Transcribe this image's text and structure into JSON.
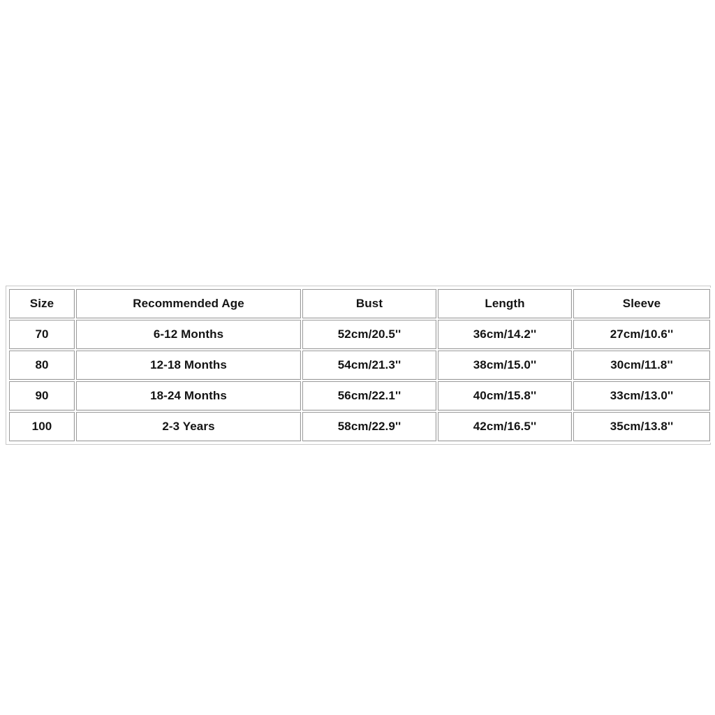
{
  "page": {
    "background_color": "#ffffff",
    "text_color": "#141414",
    "border_color": "#9a9a9a"
  },
  "size_chart": {
    "columns": [
      "Size",
      "Recommended Age",
      "Bust",
      "Length",
      "Sleeve"
    ],
    "rows": [
      {
        "size": "70",
        "age": "6-12 Months",
        "bust": "52cm/20.5''",
        "length": "36cm/14.2''",
        "sleeve": "27cm/10.6''"
      },
      {
        "size": "80",
        "age": "12-18 Months",
        "bust": "54cm/21.3''",
        "length": "38cm/15.0''",
        "sleeve": "30cm/11.8''"
      },
      {
        "size": "90",
        "age": "18-24 Months",
        "bust": "56cm/22.1''",
        "length": "40cm/15.8''",
        "sleeve": "33cm/13.0''"
      },
      {
        "size": "100",
        "age": "2-3 Years",
        "bust": "58cm/22.9''",
        "length": "42cm/16.5''",
        "sleeve": "35cm/13.8''"
      }
    ]
  },
  "chart_data": {
    "type": "table",
    "title": "",
    "columns": [
      "Size",
      "Recommended Age",
      "Bust",
      "Length",
      "Sleeve"
    ],
    "rows": [
      [
        "70",
        "6-12 Months",
        "52cm/20.5''",
        "36cm/14.2''",
        "27cm/10.6''"
      ],
      [
        "80",
        "12-18 Months",
        "54cm/21.3''",
        "38cm/15.0''",
        "30cm/11.8''"
      ],
      [
        "90",
        "18-24 Months",
        "56cm/22.1''",
        "40cm/15.8''",
        "33cm/13.0''"
      ],
      [
        "100",
        "2-3 Years",
        "58cm/22.9''",
        "42cm/16.5''",
        "35cm/13.8''"
      ]
    ]
  }
}
